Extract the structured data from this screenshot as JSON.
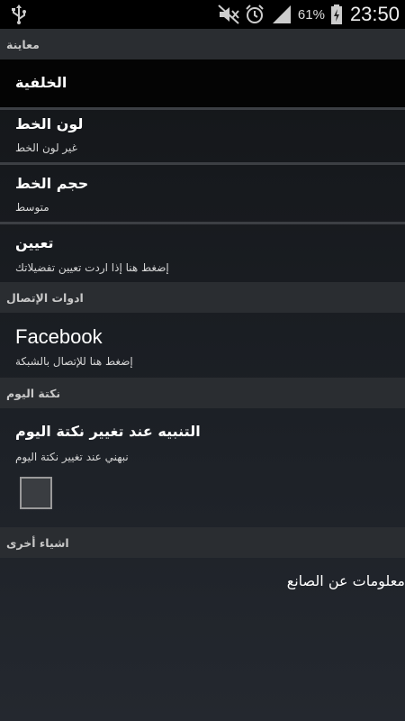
{
  "status_bar": {
    "battery_percent": "61%",
    "time": "23:50"
  },
  "sections": {
    "preview": {
      "header": "معاينة",
      "background_label": "الخلفية",
      "font_color_title": "لون الخط",
      "font_color_sub": "غير لون الخط",
      "font_size_title": "حجم الخط",
      "font_size_sub": "متوسط",
      "assign_title": "تعيين",
      "assign_sub": "إضغط هنا إذا اردت تعيين تفضيلاتك"
    },
    "connection_tools": {
      "header": "ادوات الإتصال",
      "facebook_title": "Facebook",
      "facebook_sub": "إضغط هنا للإتصال بالشبكة"
    },
    "joke_of_day": {
      "header": "نكتة اليوم",
      "notify_title": "التنبيه عند تغيير نكتة اليوم",
      "notify_sub": "نبهني عند  تغيير نكتة اليوم",
      "notify_checked": false
    },
    "other": {
      "header": "اشياء أخرى",
      "about_title": "معلومات عن الصانع"
    }
  },
  "icons": [
    "usb-icon",
    "mute-icon",
    "alarm-icon",
    "signal-icon",
    "battery-charging-icon"
  ],
  "colors": {
    "section_header_bg": "#2a2d31",
    "section_header_text": "#c8c8c8",
    "divider": "#3c3f44",
    "background": "#1d2127"
  }
}
